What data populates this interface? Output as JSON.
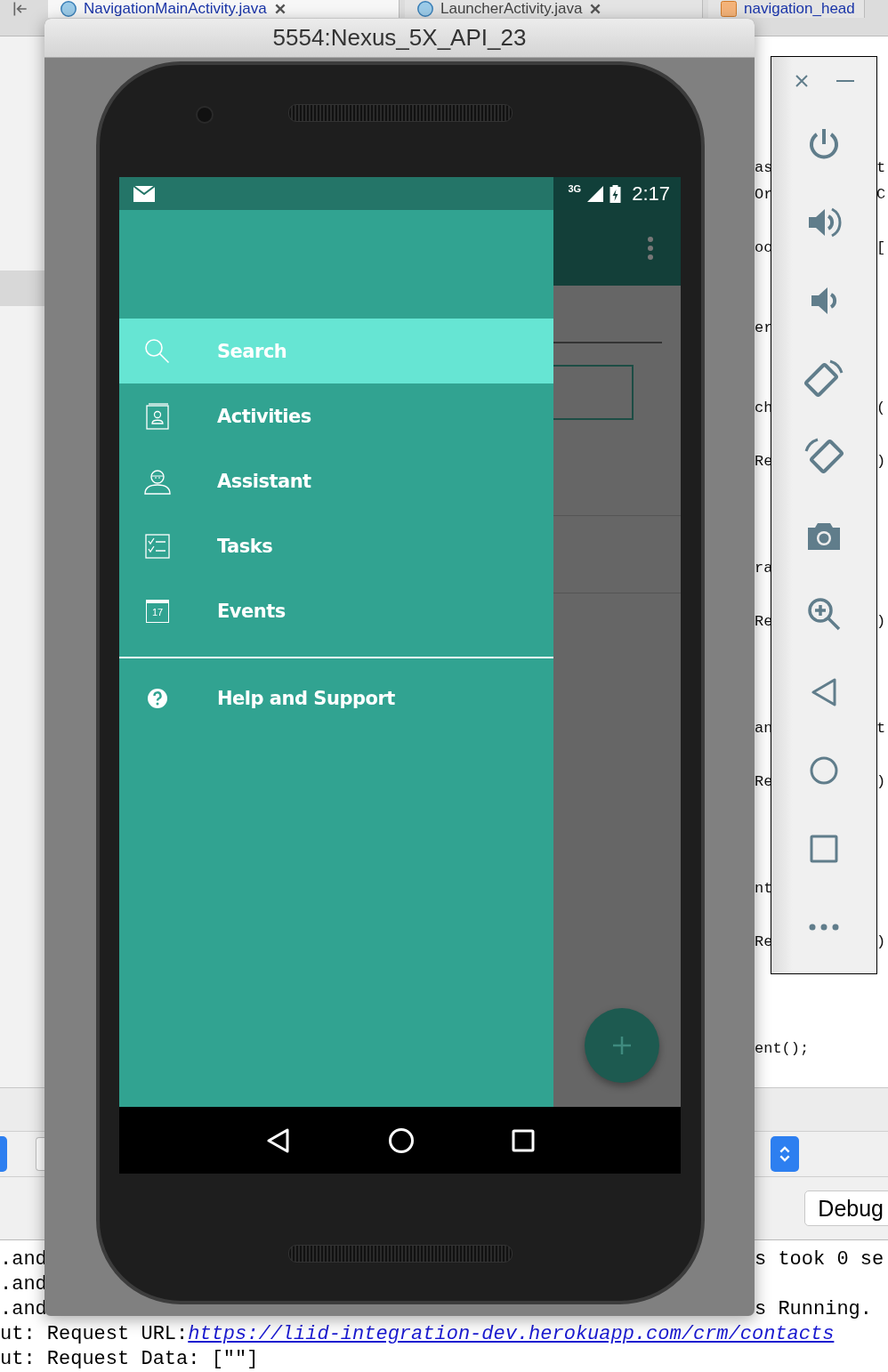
{
  "ide": {
    "tabs": [
      {
        "label": "NavigationMainActivity.java",
        "selected": true
      },
      {
        "label": "LauncherActivity.java",
        "selected": false
      },
      {
        "label": "navigation_head",
        "selected": false
      }
    ],
    "code_lines": [
      {
        "kind": "code",
        "left": "as",
        "right": "t"
      },
      {
        "kind": "code",
        "left": "Or",
        "right": "C"
      },
      {
        "kind": "blank"
      },
      {
        "kind": "code",
        "left": "oo",
        "right": "["
      },
      {
        "kind": "blank"
      },
      {
        "kind": "blank"
      },
      {
        "kind": "code",
        "left": "er"
      },
      {
        "kind": "blank"
      },
      {
        "kind": "blank"
      },
      {
        "kind": "code",
        "left": "ch",
        "right": "("
      },
      {
        "kind": "blank"
      },
      {
        "kind": "code",
        "left": "Re",
        "right": ")"
      },
      {
        "kind": "blank"
      },
      {
        "kind": "blank"
      },
      {
        "kind": "blank"
      },
      {
        "kind": "code",
        "left": "ra"
      },
      {
        "kind": "blank"
      },
      {
        "kind": "code",
        "left": "Re",
        "right": ")"
      },
      {
        "kind": "blank"
      },
      {
        "kind": "blank"
      },
      {
        "kind": "blank"
      },
      {
        "kind": "code",
        "left": "an",
        "right": "t"
      },
      {
        "kind": "blank"
      },
      {
        "kind": "code",
        "left": "Re",
        "right": ")"
      },
      {
        "kind": "blank"
      },
      {
        "kind": "blank"
      },
      {
        "kind": "blank"
      },
      {
        "kind": "code",
        "left": "nt"
      },
      {
        "kind": "blank"
      },
      {
        "kind": "code",
        "left": "Re",
        "right": ")"
      },
      {
        "kind": "blank"
      },
      {
        "kind": "blank"
      },
      {
        "kind": "blank"
      },
      {
        "kind": "code",
        "left": "ent();"
      }
    ],
    "debug_button": "Debug",
    "console_lines": [
      {
        "left": ".and",
        "right": "s took 0 se"
      },
      {
        "left": ".and"
      },
      {
        "left": ".and",
        "right": "s Running."
      },
      {
        "left": "ut: Request URL: ",
        "link": "https://liid-integration-dev.herokuapp.com/crm/contacts"
      },
      {
        "left": "ut: Request Data: [\"\"]"
      }
    ]
  },
  "emulator": {
    "title": "5554:Nexus_5X_API_23",
    "status_bar": {
      "network": "3G",
      "time": "2:17"
    },
    "drawer": {
      "items": [
        {
          "label": "Search",
          "selected": true
        },
        {
          "label": "Activities",
          "selected": false
        },
        {
          "label": "Assistant",
          "selected": false
        },
        {
          "label": "Tasks",
          "selected": false
        },
        {
          "label": "Events",
          "selected": false
        }
      ],
      "footer_items": [
        {
          "label": "Help and Support",
          "selected": false
        }
      ]
    },
    "calendar_day": "17"
  }
}
